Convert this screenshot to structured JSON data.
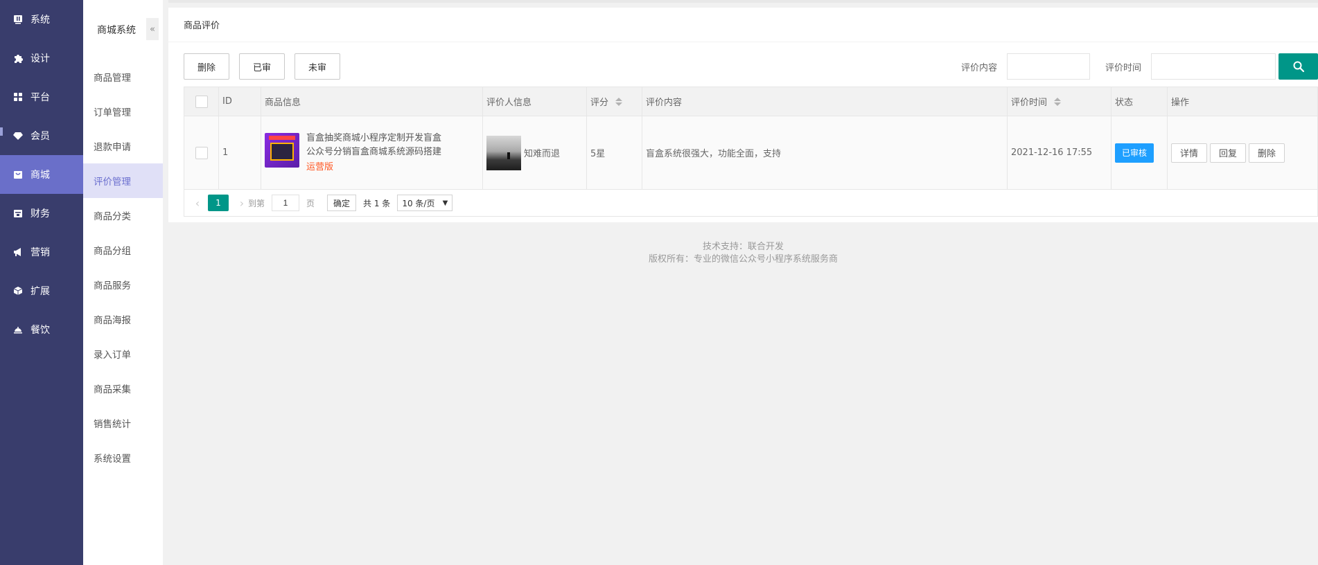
{
  "main_nav": [
    {
      "label": "系统",
      "icon": "dashboard-icon"
    },
    {
      "label": "设计",
      "icon": "puzzle-icon"
    },
    {
      "label": "平台",
      "icon": "grid-icon"
    },
    {
      "label": "会员",
      "icon": "diamond-icon"
    },
    {
      "label": "商城",
      "icon": "shop-icon"
    },
    {
      "label": "财务",
      "icon": "wallet-icon"
    },
    {
      "label": "营销",
      "icon": "megaphone-icon"
    },
    {
      "label": "扩展",
      "icon": "cube-icon"
    },
    {
      "label": "餐饮",
      "icon": "cloche-icon"
    }
  ],
  "sub_nav": {
    "title": "商城系统",
    "collapse_glyph": "«",
    "items": [
      "商品管理",
      "订单管理",
      "退款申请",
      "评价管理",
      "商品分类",
      "商品分组",
      "商品服务",
      "商品海报",
      "录入订单",
      "商品采集",
      "销售统计",
      "系统设置"
    ]
  },
  "page": {
    "title": "商品评价"
  },
  "toolbar": {
    "delete": "删除",
    "approved": "已审",
    "unapproved": "未审"
  },
  "search": {
    "content_label": "评价内容",
    "time_label": "评价时间"
  },
  "table": {
    "headers": {
      "id": "ID",
      "goods": "商品信息",
      "reviewer": "评价人信息",
      "score": "评分",
      "content": "评价内容",
      "time": "评价时间",
      "status": "状态",
      "ops": "操作"
    },
    "rows": [
      {
        "id": "1",
        "goods_name": "盲盒抽奖商城小程序定制开发盲盒公众号分销盲盒商城系统源码搭建",
        "goods_badge": "运营版",
        "reviewer": "知难而退",
        "score": "5星",
        "content": "盲盒系统很强大，功能全面，支持",
        "time": "2021-12-16 17:55",
        "status": "已审核",
        "op_detail": "详情",
        "op_reply": "回复",
        "op_delete": "删除"
      }
    ]
  },
  "pager": {
    "current": "1",
    "goto_label": "到第",
    "page_value": "1",
    "page_unit": "页",
    "confirm": "确定",
    "total": "共 1 条",
    "page_size": "10 条/页"
  },
  "footer": {
    "line1": "技术支持：联合开发",
    "line2": "版权所有：专业的微信公众号小程序系统服务商"
  },
  "colors": {
    "sidebar": "#393D6C",
    "sidebar_active": "#6a6fc9",
    "primary": "#009688",
    "status_blue": "#1e9fff",
    "badge_orange": "#ff5722"
  }
}
